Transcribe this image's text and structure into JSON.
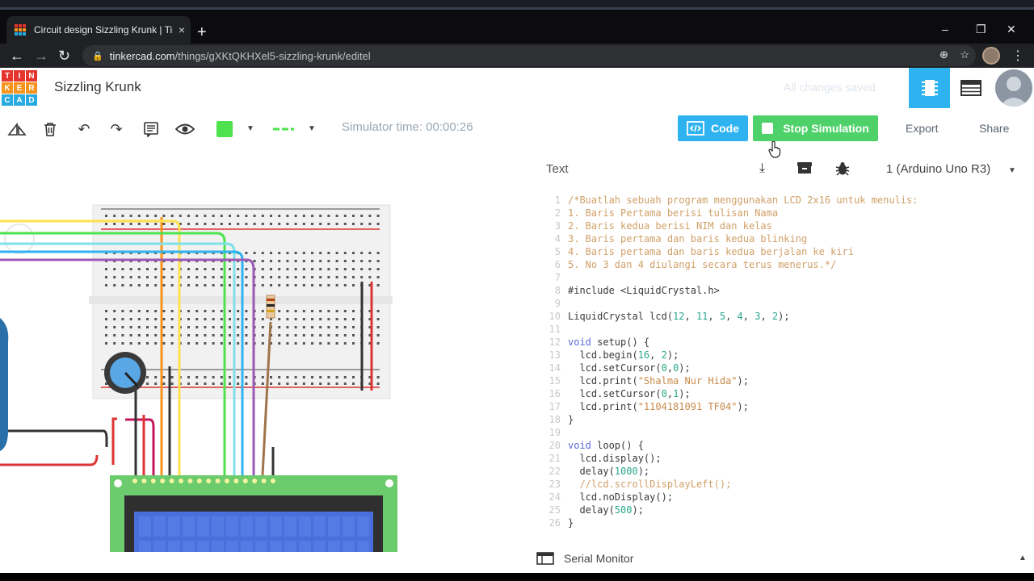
{
  "browser": {
    "tab_title": "Circuit design Sizzling Krunk | Tin",
    "tab_close": "×",
    "new_tab": "+",
    "url_host": "tinkercad.com",
    "url_path": "/things/gXKtQKHXel5-sizzling-krunk/editel"
  },
  "app": {
    "logo_letters": [
      "T",
      "I",
      "N",
      "K",
      "E",
      "R",
      "C",
      "A",
      "D"
    ],
    "logo_colors": [
      "#e4342d",
      "#e4342d",
      "#e4342d",
      "#f7941d",
      "#f7941d",
      "#f7941d",
      "#27a9e1",
      "#27a9e1",
      "#27a9e1"
    ],
    "project_title": "Sizzling Krunk",
    "ghost_text": "All changes saved"
  },
  "toolbar": {
    "sim_time": "Simulator time: 00:00:26",
    "code_label": "Code",
    "stop_label": "Stop Simulation",
    "export_label": "Export",
    "share_label": "Share",
    "wire_color": "#4ee24e"
  },
  "code_panel": {
    "mode": "Text",
    "board": "1 (Arduino Uno R3)",
    "serial_monitor": "Serial Monitor"
  },
  "code_lines": [
    {
      "n": "1",
      "segs": [
        {
          "c": "cm",
          "t": "/*Buatlah sebuah program menggunakan LCD 2x16 untuk menulis:"
        }
      ]
    },
    {
      "n": "2",
      "segs": [
        {
          "c": "cm",
          "t": "1. Baris Pertama berisi tulisan Nama"
        }
      ]
    },
    {
      "n": "3",
      "segs": [
        {
          "c": "cm",
          "t": "2. Baris kedua berisi NIM dan kelas"
        }
      ]
    },
    {
      "n": "4",
      "segs": [
        {
          "c": "cm",
          "t": "3. Baris pertama dan baris kedua blinking"
        }
      ]
    },
    {
      "n": "5",
      "segs": [
        {
          "c": "cm",
          "t": "4. Baris pertama dan baris kedua berjalan ke kiri"
        }
      ]
    },
    {
      "n": "6",
      "segs": [
        {
          "c": "cm",
          "t": "5. No 3 dan 4 diulangi secara terus menerus.*/"
        }
      ]
    },
    {
      "n": "7",
      "segs": []
    },
    {
      "n": "8",
      "segs": [
        {
          "c": "tx",
          "t": "#include <LiquidCrystal.h>"
        }
      ]
    },
    {
      "n": "9",
      "segs": []
    },
    {
      "n": "10",
      "segs": [
        {
          "c": "tx",
          "t": "LiquidCrystal lcd("
        },
        {
          "c": "num",
          "t": "12"
        },
        {
          "c": "tx",
          "t": ", "
        },
        {
          "c": "num",
          "t": "11"
        },
        {
          "c": "tx",
          "t": ", "
        },
        {
          "c": "num",
          "t": "5"
        },
        {
          "c": "tx",
          "t": ", "
        },
        {
          "c": "num",
          "t": "4"
        },
        {
          "c": "tx",
          "t": ", "
        },
        {
          "c": "num",
          "t": "3"
        },
        {
          "c": "tx",
          "t": ", "
        },
        {
          "c": "num",
          "t": "2"
        },
        {
          "c": "tx",
          "t": ");"
        }
      ]
    },
    {
      "n": "11",
      "segs": []
    },
    {
      "n": "12",
      "segs": [
        {
          "c": "kw",
          "t": "void"
        },
        {
          "c": "tx",
          "t": " setup() {"
        }
      ]
    },
    {
      "n": "13",
      "segs": [
        {
          "c": "tx",
          "t": "  lcd.begin("
        },
        {
          "c": "num",
          "t": "16"
        },
        {
          "c": "tx",
          "t": ", "
        },
        {
          "c": "num",
          "t": "2"
        },
        {
          "c": "tx",
          "t": ");"
        }
      ]
    },
    {
      "n": "14",
      "segs": [
        {
          "c": "tx",
          "t": "  lcd.setCursor("
        },
        {
          "c": "num",
          "t": "0"
        },
        {
          "c": "tx",
          "t": ","
        },
        {
          "c": "num",
          "t": "0"
        },
        {
          "c": "tx",
          "t": ");"
        }
      ]
    },
    {
      "n": "15",
      "segs": [
        {
          "c": "tx",
          "t": "  lcd.print("
        },
        {
          "c": "str",
          "t": "\"Shalma Nur Hida\""
        },
        {
          "c": "tx",
          "t": ");"
        }
      ]
    },
    {
      "n": "16",
      "segs": [
        {
          "c": "tx",
          "t": "  lcd.setCursor("
        },
        {
          "c": "num",
          "t": "0"
        },
        {
          "c": "tx",
          "t": ","
        },
        {
          "c": "num",
          "t": "1"
        },
        {
          "c": "tx",
          "t": ");"
        }
      ]
    },
    {
      "n": "17",
      "segs": [
        {
          "c": "tx",
          "t": "  lcd.print("
        },
        {
          "c": "str",
          "t": "\"1104181091 TF04\""
        },
        {
          "c": "tx",
          "t": ");"
        }
      ]
    },
    {
      "n": "18",
      "segs": [
        {
          "c": "tx",
          "t": "}"
        }
      ]
    },
    {
      "n": "19",
      "segs": []
    },
    {
      "n": "20",
      "segs": [
        {
          "c": "kw",
          "t": "void"
        },
        {
          "c": "tx",
          "t": " loop() {"
        }
      ]
    },
    {
      "n": "21",
      "segs": [
        {
          "c": "tx",
          "t": "  lcd.display();"
        }
      ]
    },
    {
      "n": "22",
      "segs": [
        {
          "c": "tx",
          "t": "  delay("
        },
        {
          "c": "num",
          "t": "1000"
        },
        {
          "c": "tx",
          "t": ");"
        }
      ]
    },
    {
      "n": "23",
      "segs": [
        {
          "c": "cm",
          "t": "  //lcd.scrollDisplayLeft();"
        }
      ]
    },
    {
      "n": "24",
      "segs": [
        {
          "c": "tx",
          "t": "  lcd.noDisplay();"
        }
      ]
    },
    {
      "n": "25",
      "segs": [
        {
          "c": "tx",
          "t": "  delay("
        },
        {
          "c": "num",
          "t": "500"
        },
        {
          "c": "tx",
          "t": ");"
        }
      ]
    },
    {
      "n": "26",
      "segs": [
        {
          "c": "tx",
          "t": "}"
        }
      ]
    }
  ]
}
